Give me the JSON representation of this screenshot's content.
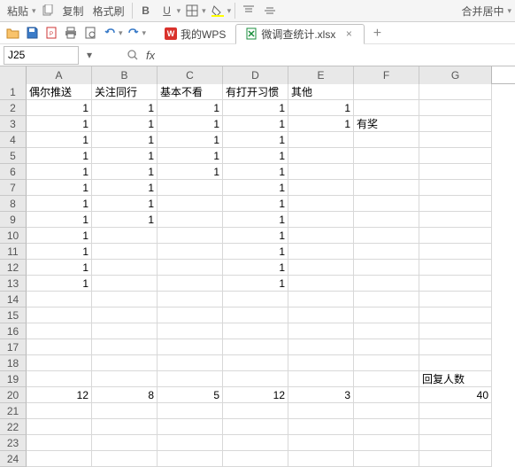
{
  "toolbar_top": {
    "paste_label": "粘贴",
    "copy_label": "复制",
    "format_painter_label": "格式刷",
    "merge_center_label": "合并居中"
  },
  "tabs": {
    "home_tab": "我的WPS",
    "file_tab": "微调查统计.xlsx"
  },
  "formula_bar": {
    "cell_ref": "J25",
    "fx_label": "fx",
    "formula_value": ""
  },
  "columns": [
    "A",
    "B",
    "C",
    "D",
    "E",
    "F",
    "G"
  ],
  "headers": {
    "A": "偶尔推送",
    "B": "关注同行",
    "C": "基本不看",
    "D": "有打开习惯",
    "E": "其他",
    "F": "有奖",
    "G": "回复人数"
  },
  "data": {
    "1": {
      "A": "偶尔推送",
      "B": "关注同行",
      "C": "基本不看",
      "D": "有打开习惯",
      "E": "其他"
    },
    "2": {
      "A": "1",
      "B": "1",
      "C": "1",
      "D": "1",
      "E": "1"
    },
    "3": {
      "A": "1",
      "B": "1",
      "C": "1",
      "D": "1",
      "E": "1",
      "F": "有奖"
    },
    "4": {
      "A": "1",
      "B": "1",
      "C": "1",
      "D": "1"
    },
    "5": {
      "A": "1",
      "B": "1",
      "C": "1",
      "D": "1"
    },
    "6": {
      "A": "1",
      "B": "1",
      "C": "1",
      "D": "1"
    },
    "7": {
      "A": "1",
      "B": "1",
      "D": "1"
    },
    "8": {
      "A": "1",
      "B": "1",
      "D": "1"
    },
    "9": {
      "A": "1",
      "B": "1",
      "D": "1"
    },
    "10": {
      "A": "1",
      "D": "1"
    },
    "11": {
      "A": "1",
      "D": "1"
    },
    "12": {
      "A": "1",
      "D": "1"
    },
    "13": {
      "A": "1",
      "D": "1"
    },
    "19": {
      "G": "回复人数"
    },
    "20": {
      "A": "12",
      "B": "8",
      "C": "5",
      "D": "12",
      "E": "3",
      "G": "40"
    }
  },
  "row_count": 24
}
